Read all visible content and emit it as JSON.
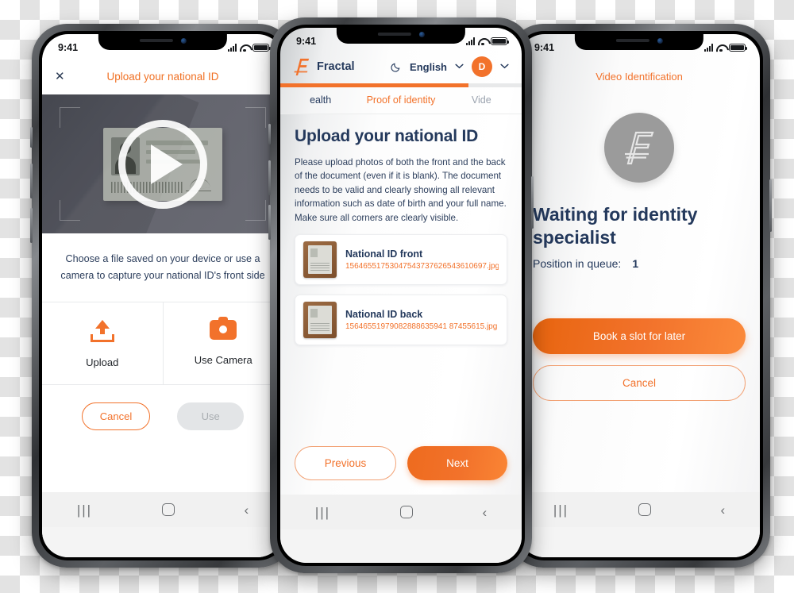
{
  "phone1": {
    "status_bar": {
      "time": "9:41"
    },
    "header": {
      "close_icon": "close-icon",
      "title": "Upload your national ID"
    },
    "camera": {
      "play_icon": "play-icon",
      "card_icon": "id-card-illustration"
    },
    "instruction": "Choose a file saved on your device or use a camera to capture your national ID's front side",
    "choices": [
      {
        "icon": "upload-icon",
        "label": "Upload"
      },
      {
        "icon": "camera-icon",
        "label": "Use Camera"
      }
    ],
    "actions": {
      "cancel": "Cancel",
      "use": "Use"
    },
    "nav": {
      "recent": "|||",
      "home": "home-icon",
      "back": "‹"
    }
  },
  "phone2": {
    "status_bar": {
      "time": "9:41"
    },
    "header": {
      "brand": "Fractal",
      "brand_icon": "fractal-logo-icon",
      "dark_mode_icon": "moon-icon",
      "language": "English",
      "language_chevron": "⌄",
      "avatar_initial": "D",
      "avatar_chevron": "⌄"
    },
    "progress_percent": 78,
    "tabs": [
      {
        "label": "ealth",
        "state": "muted"
      },
      {
        "label": "Proof of identity",
        "state": "active"
      },
      {
        "label": "Vide",
        "state": "muted"
      }
    ],
    "heading": "Upload your national ID",
    "paragraph": "Please upload photos of both the front and the back of the document (even if it is blank). The document needs to be valid and clearly showing all relevant information such as date of birth and your full name. Make sure all corners are clearly visible.",
    "files": [
      {
        "name": "National ID front",
        "id": "15646551753047543737626543610697.jpg",
        "thumb_icon": "id-document-thumbnail"
      },
      {
        "name": "National ID back",
        "id": "15646551979082888635941 87455615.jpg",
        "thumb_icon": "id-document-thumbnail"
      }
    ],
    "footer": {
      "previous": "Previous",
      "next": "Next"
    },
    "nav": {
      "recent": "|||",
      "home": "home-icon",
      "back": "‹"
    }
  },
  "phone3": {
    "status_bar": {
      "time": "9:41"
    },
    "title": "Video Identification",
    "logo_icon": "fractal-logo-icon",
    "heading": "Waiting for identity specialist",
    "queue_label": "Position in queue:",
    "queue_value": "1",
    "actions": {
      "book": "Book a slot for later",
      "cancel": "Cancel"
    },
    "nav": {
      "recent": "|||",
      "home": "home-icon",
      "back": "‹"
    }
  },
  "colors": {
    "accent": "#f2722b",
    "navy": "#24395c",
    "muted": "#9aa2ae",
    "logo_grey": "#9b9b9b"
  }
}
